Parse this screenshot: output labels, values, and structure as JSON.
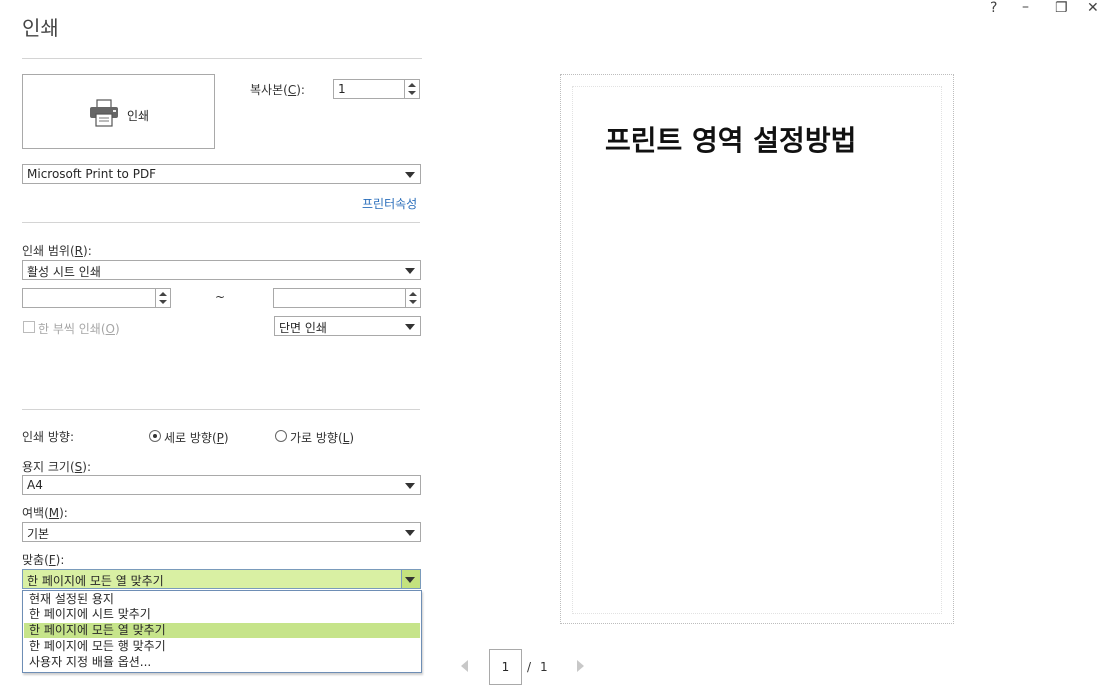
{
  "window": {
    "title": "인쇄",
    "help_icon": "?",
    "minimize_icon": "–",
    "restore_icon": "❐",
    "close_icon": "✕"
  },
  "print_button": {
    "label": "인쇄",
    "icon": "printer-icon"
  },
  "copies": {
    "label_pre": "복사본(",
    "label_key": "C",
    "label_post": "):",
    "value": "1"
  },
  "printer": {
    "selected": "Microsoft Print to PDF",
    "properties_link": "프린터속성"
  },
  "range": {
    "label_pre": "인쇄 범위(",
    "label_key": "R",
    "label_post": "):",
    "selected": "활성 시트 인쇄",
    "from_value": "",
    "tilde": "~",
    "to_value": ""
  },
  "duplex_checkbox": {
    "label_pre": "한 부씩 인쇄(",
    "label_key": "O",
    "label_post": ")",
    "checked": false
  },
  "sides": {
    "selected": "단면 인쇄"
  },
  "orientation": {
    "label": "인쇄 방향:",
    "portrait_pre": "세로 방향(",
    "portrait_key": "P",
    "portrait_post": ")",
    "landscape_pre": "가로 방향(",
    "landscape_key": "L",
    "landscape_post": ")",
    "selected": "portrait"
  },
  "paper_size": {
    "label_pre": "용지 크기(",
    "label_key": "S",
    "label_post": "):",
    "selected": "A4"
  },
  "margins": {
    "label_pre": "여백(",
    "label_key": "M",
    "label_post": "):",
    "selected": "기본"
  },
  "fit": {
    "label_pre": "맞춤(",
    "label_key": "F",
    "label_post": "):",
    "selected": "한 페이지에 모든 열 맞추기",
    "options": [
      "현재 설정된 용지",
      "한 페이지에 시트 맞추기",
      "한 페이지에 모든 열 맞추기",
      "한 페이지에 모든 행 맞추기",
      "사용자 지정 배율 옵션..."
    ],
    "highlighted_index": 2
  },
  "preview": {
    "heading": "프린트 영역 설정방법"
  },
  "pager": {
    "current": "1",
    "separator": "/",
    "total": "1"
  },
  "colors": {
    "accent_link": "#2a6ebb",
    "selection_green": "#c6e48a"
  }
}
